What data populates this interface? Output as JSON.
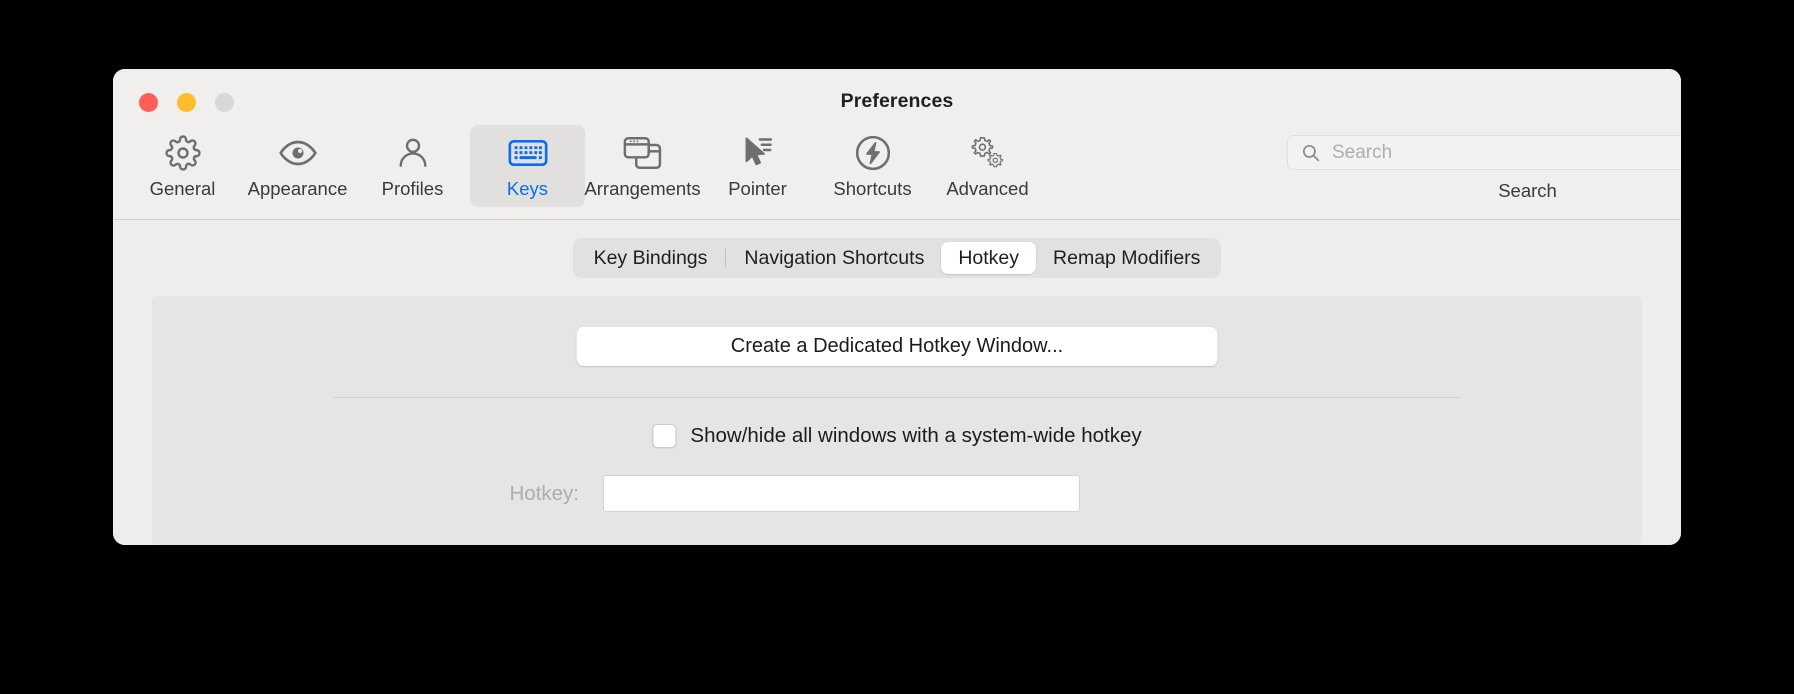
{
  "window": {
    "title": "Preferences",
    "traffic_lights": [
      {
        "name": "close",
        "color": "#FF5F57"
      },
      {
        "name": "minimize",
        "color": "#FEBC2E"
      },
      {
        "name": "zoom",
        "color": "#D8D8D8"
      }
    ]
  },
  "toolbar": {
    "items": [
      {
        "label": "General",
        "icon": "gear-icon",
        "active": false
      },
      {
        "label": "Appearance",
        "icon": "eye-icon",
        "active": false
      },
      {
        "label": "Profiles",
        "icon": "person-icon",
        "active": false
      },
      {
        "label": "Keys",
        "icon": "keyboard-icon",
        "active": true
      },
      {
        "label": "Arrangements",
        "icon": "windows-icon",
        "active": false
      },
      {
        "label": "Pointer",
        "icon": "cursor-icon",
        "active": false
      },
      {
        "label": "Shortcuts",
        "icon": "bolt-circle-icon",
        "active": false
      },
      {
        "label": "Advanced",
        "icon": "gears-icon",
        "active": false
      }
    ],
    "accent_color": "#0A6CF0",
    "inactive_color": "#6E6E6E"
  },
  "search": {
    "placeholder": "Search",
    "value": "",
    "caption": "Search",
    "icon": "magnifier-icon"
  },
  "tabs": [
    {
      "label": "Key Bindings",
      "active": false
    },
    {
      "label": "Navigation Shortcuts",
      "active": false
    },
    {
      "label": "Hotkey",
      "active": true
    },
    {
      "label": "Remap Modifiers",
      "active": false
    }
  ],
  "panel": {
    "create_button": "Create a Dedicated Hotkey Window...",
    "checkbox": {
      "label": "Show/hide all windows with a system-wide hotkey",
      "checked": false
    },
    "hotkey": {
      "label": "Hotkey:",
      "value": "",
      "enabled": false
    }
  }
}
